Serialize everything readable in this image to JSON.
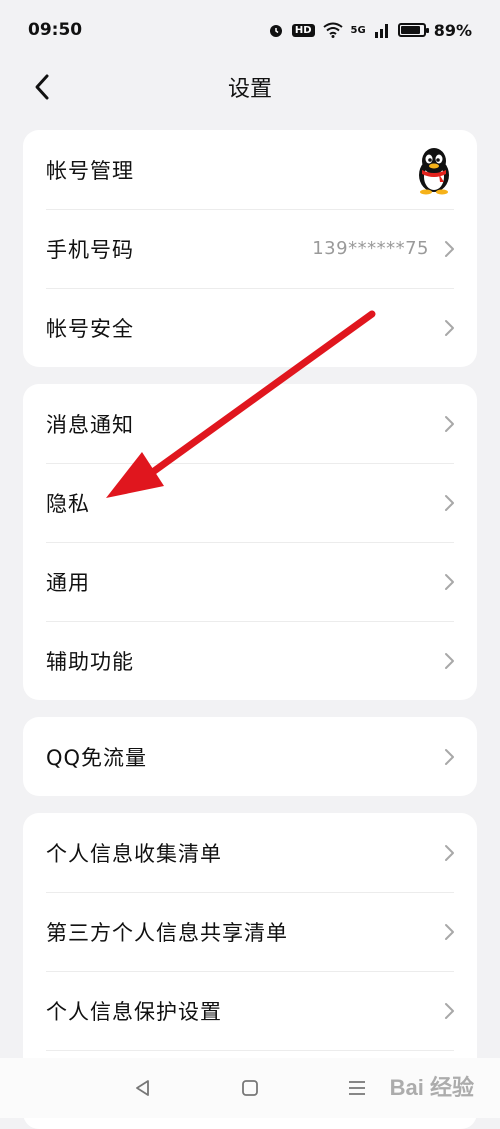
{
  "status": {
    "time": "09:50",
    "hd": "HD",
    "signal": "5G",
    "battery": "89%",
    "battery_level": 0.89
  },
  "header": {
    "title": "设置"
  },
  "group1": [
    {
      "label": "帐号管理"
    },
    {
      "label": "手机号码",
      "value": "139******75"
    },
    {
      "label": "帐号安全"
    }
  ],
  "group2": [
    {
      "label": "消息通知"
    },
    {
      "label": "隐私"
    },
    {
      "label": "通用"
    },
    {
      "label": "辅助功能"
    }
  ],
  "group3": [
    {
      "label": "QQ免流量"
    }
  ],
  "group4": [
    {
      "label": "个人信息收集清单"
    },
    {
      "label": "第三方个人信息共享清单"
    },
    {
      "label": "个人信息保护设置"
    }
  ],
  "watermark": "Bai 经验",
  "colors": {
    "background": "#f2f2f4",
    "card": "#ffffff",
    "annotation_arrow": "#e0161e"
  }
}
